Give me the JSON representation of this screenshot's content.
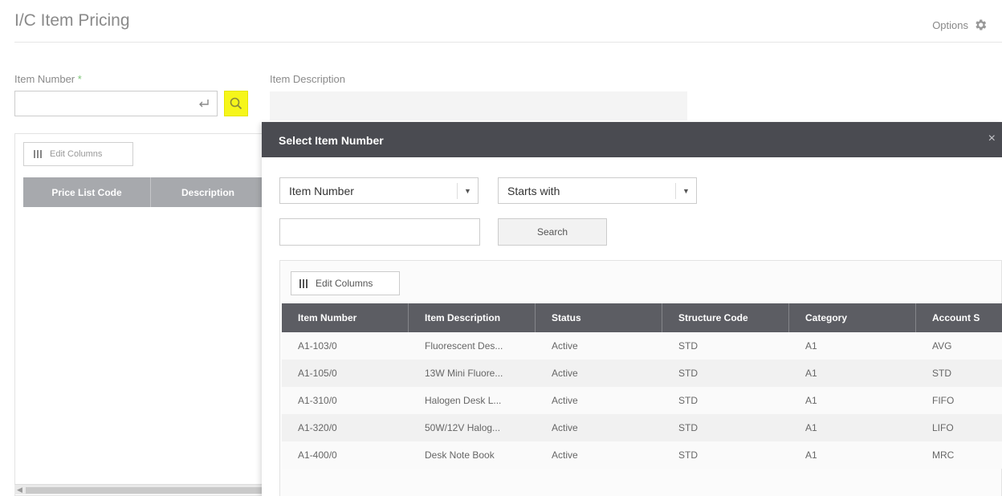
{
  "header": {
    "title": "I/C Item Pricing",
    "options_label": "Options"
  },
  "form": {
    "item_number_label": "Item Number",
    "required_mark": "*",
    "item_number_value": "",
    "item_description_label": "Item Description"
  },
  "left_grid": {
    "edit_columns_label": "Edit Columns",
    "columns": [
      "Price List Code",
      "Description"
    ]
  },
  "modal": {
    "title": "Select Item Number",
    "close_glyph": "×",
    "field_select": "Item Number",
    "operator_select": "Starts with",
    "search_value": "",
    "search_button": "Search",
    "edit_columns_label": "Edit Columns",
    "columns": [
      "Item Number",
      "Item Description",
      "Status",
      "Structure Code",
      "Category",
      "Account S"
    ],
    "rows": [
      [
        "A1-103/0",
        "Fluorescent Des...",
        "Active",
        "STD",
        "A1",
        "AVG"
      ],
      [
        "A1-105/0",
        "13W Mini Fluore...",
        "Active",
        "STD",
        "A1",
        "STD"
      ],
      [
        "A1-310/0",
        "Halogen Desk L...",
        "Active",
        "STD",
        "A1",
        "FIFO"
      ],
      [
        "A1-320/0",
        "50W/12V Halog...",
        "Active",
        "STD",
        "A1",
        "LIFO"
      ],
      [
        "A1-400/0",
        "Desk Note Book",
        "Active",
        "STD",
        "A1",
        "MRC"
      ]
    ]
  },
  "icons": {
    "gear": "gear-icon",
    "enter": "enter-return-icon",
    "search": "search-icon",
    "columns": "columns-icon",
    "caret": "caret-down-icon",
    "close": "close-icon"
  },
  "colors": {
    "search_highlight": "#f6f61a",
    "modal_header": "#4a4b51",
    "grid_header": "#5c5d63",
    "left_grid_header": "#a7a9ad",
    "required": "#7cc576"
  }
}
